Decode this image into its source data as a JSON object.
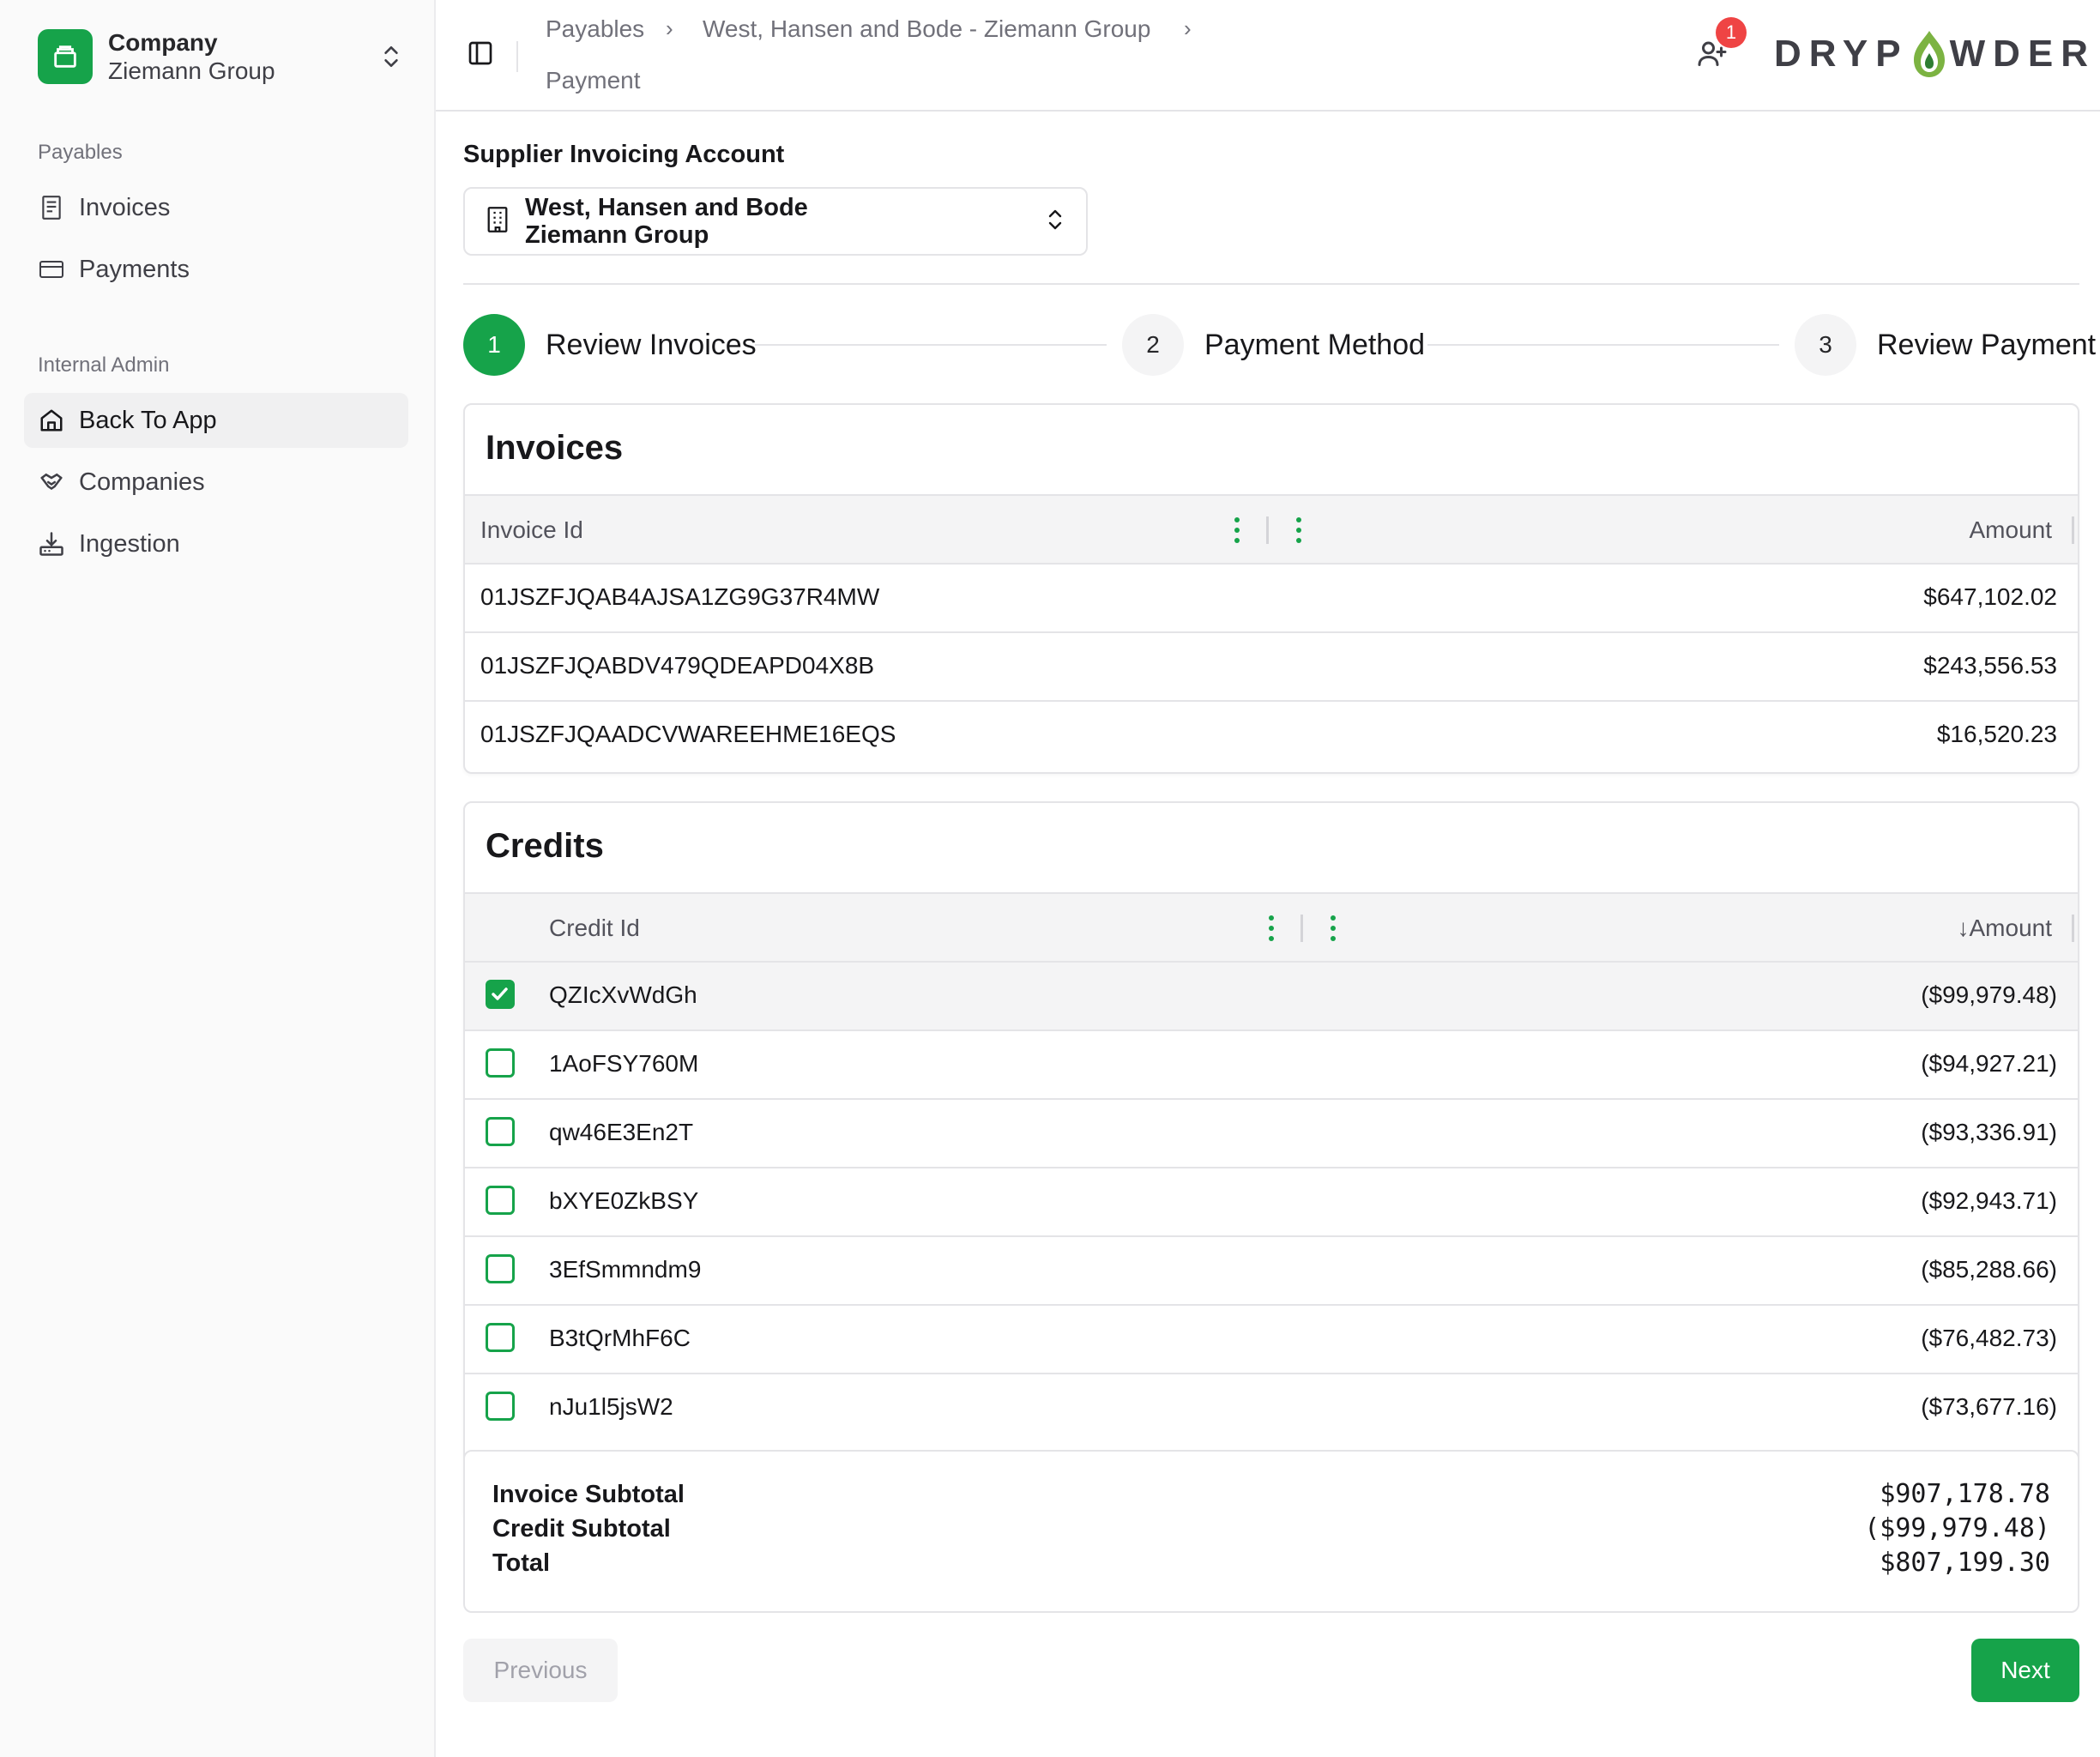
{
  "sidebar": {
    "company": {
      "label": "Company",
      "name": "Ziemann Group"
    },
    "groups": [
      {
        "title": "Payables",
        "items": [
          {
            "label": "Invoices",
            "icon": "receipt-icon"
          },
          {
            "label": "Payments",
            "icon": "credit-card-icon"
          }
        ]
      },
      {
        "title": "Internal Admin",
        "items": [
          {
            "label": "Back To App",
            "icon": "home-icon",
            "active": true
          },
          {
            "label": "Companies",
            "icon": "handshake-icon"
          },
          {
            "label": "Ingestion",
            "icon": "import-icon"
          }
        ]
      }
    ]
  },
  "header": {
    "breadcrumb": [
      "Payables",
      "West, Hansen and Bode - Ziemann Group",
      "Payment"
    ],
    "notification_count": "1",
    "brand": {
      "left": "DRYP",
      "right": "WDER"
    }
  },
  "account": {
    "label": "Supplier Invoicing Account",
    "line1": "West, Hansen and Bode",
    "line2": "Ziemann Group"
  },
  "steps": [
    {
      "number": "1",
      "label": "Review Invoices",
      "active": true
    },
    {
      "number": "2",
      "label": "Payment Method",
      "active": false
    },
    {
      "number": "3",
      "label": "Review Payment",
      "active": false
    }
  ],
  "invoices": {
    "title": "Invoices",
    "columns": {
      "id": "Invoice Id",
      "amount": "Amount"
    },
    "rows": [
      {
        "id": "01JSZFJQAB4AJSA1ZG9G37R4MW",
        "amount": "$647,102.02"
      },
      {
        "id": "01JSZFJQABDV479QDEAPD04X8B",
        "amount": "$243,556.53"
      },
      {
        "id": "01JSZFJQAADCVWAREEHME16EQS",
        "amount": "$16,520.23"
      }
    ]
  },
  "credits": {
    "title": "Credits",
    "columns": {
      "id": "Credit Id",
      "amount": "Amount",
      "sort_arrow": "↓"
    },
    "rows": [
      {
        "id": "QZIcXvWdGh",
        "amount": "($99,979.48)",
        "checked": true
      },
      {
        "id": "1AoFSY760M",
        "amount": "($94,927.21)",
        "checked": false
      },
      {
        "id": "qw46E3En2T",
        "amount": "($93,336.91)",
        "checked": false
      },
      {
        "id": "bXYE0ZkBSY",
        "amount": "($92,943.71)",
        "checked": false
      },
      {
        "id": "3EfSmmndm9",
        "amount": "($85,288.66)",
        "checked": false
      },
      {
        "id": "B3tQrMhF6C",
        "amount": "($76,482.73)",
        "checked": false
      },
      {
        "id": "nJu1l5jsW2",
        "amount": "($73,677.16)",
        "checked": false
      }
    ]
  },
  "totals": {
    "invoice_subtotal_label": "Invoice Subtotal",
    "invoice_subtotal": "$907,178.78",
    "credit_subtotal_label": "Credit Subtotal",
    "credit_subtotal": "($99,979.48)",
    "total_label": "Total",
    "total": "$807,199.30"
  },
  "actions": {
    "previous": "Previous",
    "next": "Next"
  },
  "colors": {
    "accent": "#16a34a",
    "badge": "#ef4444"
  }
}
